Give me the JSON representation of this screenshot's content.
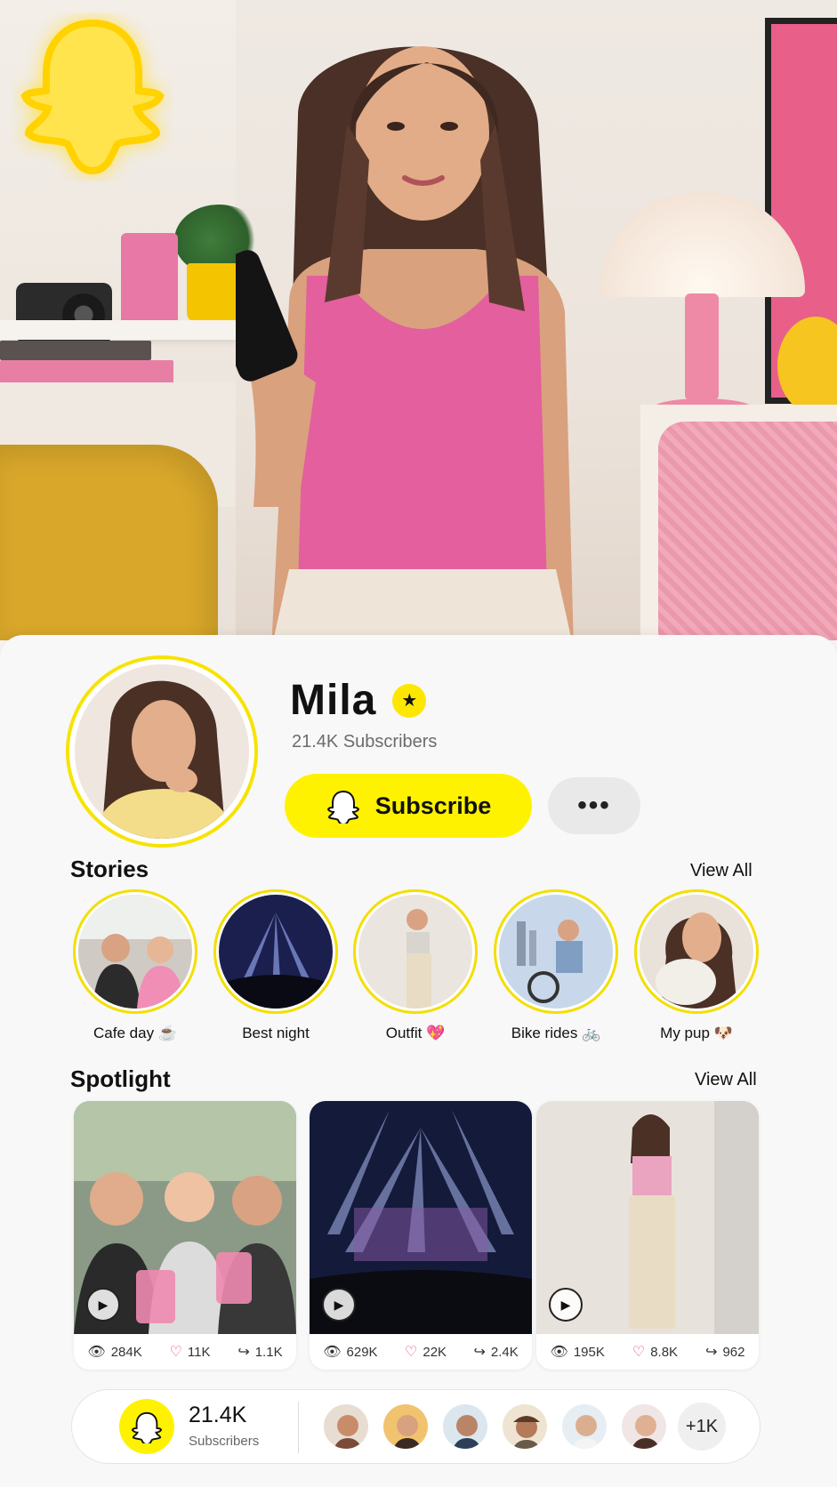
{
  "profile": {
    "name": "Mila",
    "subscribers_line": "21.4K Subscribers",
    "subscribe_label": "Subscribe",
    "more_label": "•••"
  },
  "stories": {
    "title": "Stories",
    "view_all": "View All",
    "items": [
      {
        "label": "Cafe day ☕"
      },
      {
        "label": "Best night"
      },
      {
        "label": "Outfit 💖"
      },
      {
        "label": "Bike rides 🚲"
      },
      {
        "label": "My pup 🐶"
      }
    ]
  },
  "spotlight": {
    "title": "Spotlight",
    "view_all": "View All",
    "items": [
      {
        "views": "284K",
        "likes": "11K",
        "shares": "1.1K"
      },
      {
        "views": "629K",
        "likes": "22K",
        "shares": "2.4K"
      },
      {
        "views": "195K",
        "likes": "8.8K",
        "shares": "962"
      }
    ]
  },
  "footer": {
    "count": "21.4K",
    "label": "Subscribers",
    "more": "+1K"
  },
  "colors": {
    "brand_yellow": "#FFF200",
    "ring_yellow": "#F3DF00",
    "heart_pink": "#E8457A"
  },
  "icons": [
    "ghost-icon",
    "star-icon",
    "eye-icon",
    "heart-icon",
    "share-icon",
    "play-icon"
  ]
}
